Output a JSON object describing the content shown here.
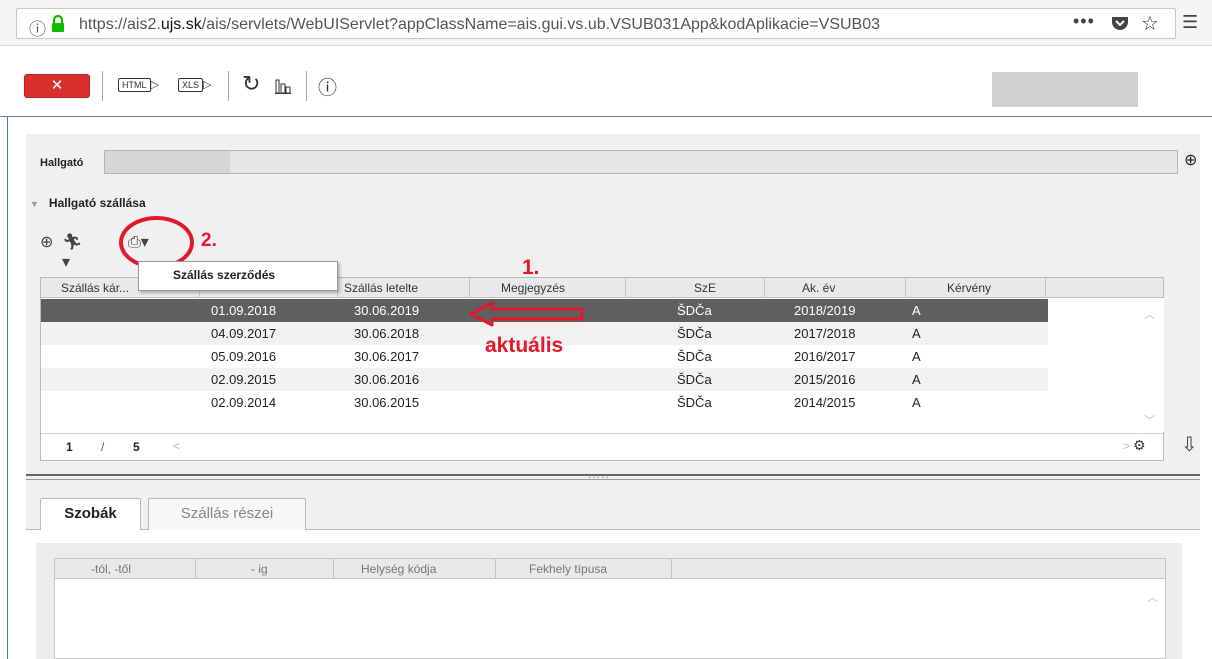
{
  "browser": {
    "url_prefix": "https://ais2.",
    "url_domain": "ujs.sk",
    "url_rest": "/ais/servlets/WebUIServlet?appClassName=ais.gui.vs.ub.VSUB031App&kodAplikacie=VSUB03",
    "more_icon": "•••"
  },
  "toolbar": {
    "close_label": "✕",
    "html_label": "HTML",
    "xls_label": "XLS"
  },
  "student": {
    "label": "Hallgató"
  },
  "section": {
    "title": "Hallgató szállása"
  },
  "popup": {
    "item": "Szállás szerződés"
  },
  "annotations": {
    "step1": "1.",
    "step2": "2.",
    "current": "aktuális",
    "color": "#e3182b"
  },
  "table": {
    "columns": [
      "Szállás kár...",
      "",
      "Szállás letelte",
      "Megjegyzés",
      "SzE",
      "Ak. év",
      "Kérvény"
    ],
    "rows": [
      {
        "from": "01.09.2018",
        "to": "30.06.2019",
        "sze": "ŠDČa",
        "year": "2018/2019",
        "request": "A"
      },
      {
        "from": "04.09.2017",
        "to": "30.06.2018",
        "sze": "ŠDČa",
        "year": "2017/2018",
        "request": "A"
      },
      {
        "from": "05.09.2016",
        "to": "30.06.2017",
        "sze": "ŠDČa",
        "year": "2016/2017",
        "request": "A"
      },
      {
        "from": "02.09.2015",
        "to": "30.06.2016",
        "sze": "ŠDČa",
        "year": "2015/2016",
        "request": "A"
      },
      {
        "from": "02.09.2014",
        "to": "30.06.2015",
        "sze": "ŠDČa",
        "year": "2014/2015",
        "request": "A"
      }
    ],
    "page_current": "1",
    "page_sep": "/",
    "page_total": "5"
  },
  "tabs": {
    "rooms": "Szobák",
    "parts": "Szállás részei"
  },
  "subtable": {
    "columns": [
      "-tól, -től",
      "- ig",
      "Helység kódja",
      "Fekhely típusa"
    ]
  }
}
